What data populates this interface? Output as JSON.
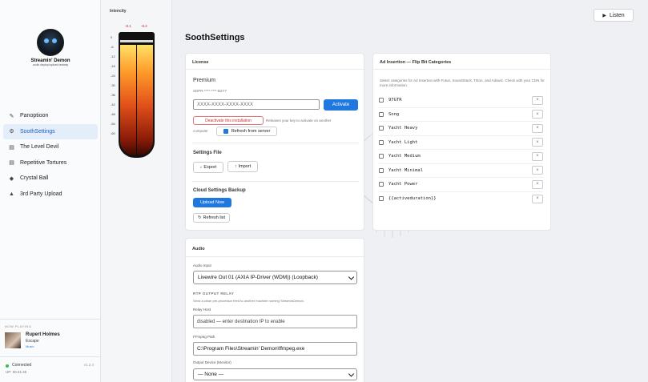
{
  "sidebar": {
    "logo_name": "Streamin' Demon",
    "logo_tag": "audio daytop/upload fastway",
    "items": [
      {
        "label": "Panoptioon",
        "icon": "pin-icon"
      },
      {
        "label": "SoothSettings",
        "icon": "gear-icon"
      },
      {
        "label": "The Level Devil",
        "icon": "document-icon"
      },
      {
        "label": "Repetitive Tortures",
        "icon": "document-icon"
      },
      {
        "label": "Crystal Ball",
        "icon": "crystal-icon"
      },
      {
        "label": "3rd Party Upload",
        "icon": "upload-icon"
      }
    ],
    "now_playing": {
      "label": "NOW PLAYING",
      "title": "Rupert Holmes",
      "subtitle": "Escape",
      "tag": "Music"
    },
    "status": {
      "text": "Connected",
      "version": "v1.2.4",
      "uptime": "UP: 00:41:45"
    }
  },
  "meter": {
    "title": "Intencity",
    "peaks": [
      "-8.1",
      "-8.2"
    ],
    "scale": [
      "0",
      "-6",
      "-12",
      "-18",
      "-24",
      "-30",
      "-36",
      "-42",
      "-48",
      "-54",
      "-60"
    ]
  },
  "header": {
    "title": "SoothSettings",
    "listen_label": "Listen"
  },
  "license": {
    "heading": "License",
    "tier": "Premium",
    "serial": "SDPR-****-****-B2Y7",
    "key_placeholder": "XXXX-XXXX-XXXX-XXXX",
    "activate_label": "Activate",
    "deactivate_label": "Deactivate this installation",
    "deactivate_help": "Releases your key to activate on another",
    "computer_label": "computer",
    "refresh_label": "Refresh from server",
    "settings_file_heading": "Settings File",
    "export_label": "Export",
    "import_label": "Import",
    "cloud_heading": "Cloud Settings Backup",
    "upload_label": "Upload Now",
    "refresh_list_label": "Refresh list"
  },
  "ad": {
    "heading": "Ad Insertion — Flip Bit Categories",
    "help": "Select categories for Ad Insertion with Futuri, SoundStack, Triton, and Adswiz. Check with your CDN for more information.",
    "categories": [
      "97GTR",
      "Song",
      "Yacht Heavy",
      "Yacht Light",
      "Yacht Medium",
      "Yacht Minimal",
      "Yacht Power",
      "{{activeduration}}"
    ]
  },
  "audio": {
    "heading": "Audio",
    "input_label": "Audio Input",
    "input_value": "Livewire Out 01 (AXIA IP-Driver (WDM)) (Loopback)",
    "relay_heading": "RTP OUTPUT RELAY",
    "relay_help": "Send a clean pre-processor feed to another machine running StreaminDemon.",
    "relay_host_label": "Relay Host",
    "relay_host_placeholder": "disabled — enter destination IP to enable",
    "ffmpeg_label": "FFmpeg Path",
    "ffmpeg_value": "C:\\Program Files\\Streamin' Demon\\ffmpeg.exe",
    "output_label": "Output Device (Monitor)",
    "output_value": "— None —"
  }
}
